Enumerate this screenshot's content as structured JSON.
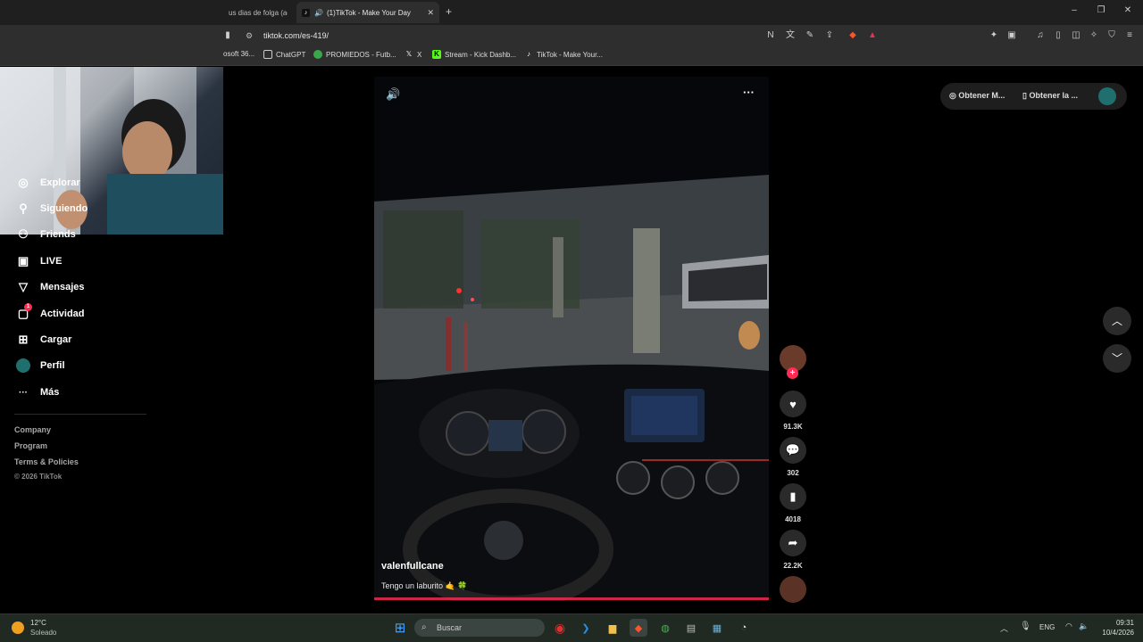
{
  "browser": {
    "tabs": [
      {
        "label": "us dias de folga (acc",
        "active": false
      },
      {
        "label": "(1)TikTok - Make Your Day",
        "active": true
      }
    ],
    "new_tab": "+",
    "window_controls": {
      "minimize": "–",
      "restore": "❐",
      "close": "✕"
    },
    "url": "tiktok.com/es-419/",
    "bookmarks": [
      {
        "label": "osoft 36...",
        "icon": "microsoft-icon"
      },
      {
        "label": "ChatGPT",
        "icon": "chatgpt-icon"
      },
      {
        "label": "PROMIEDOS - Futb...",
        "icon": "promiedos-icon"
      },
      {
        "label": "X",
        "icon": "x-icon"
      },
      {
        "label": "Stream - Kick Dashb...",
        "icon": "kick-icon"
      },
      {
        "label": "TikTok - Make Your...",
        "icon": "tiktok-icon"
      }
    ]
  },
  "sidebar": {
    "items": [
      {
        "label": "Explorar",
        "icon": "compass-icon",
        "glyph": "◎"
      },
      {
        "label": "Siguiendo",
        "icon": "person-icon",
        "glyph": "⚇"
      },
      {
        "label": "Friends",
        "icon": "friends-icon",
        "glyph": "⚇"
      },
      {
        "label": "LIVE",
        "icon": "live-tv-icon",
        "glyph": "▣"
      },
      {
        "label": "Mensajes",
        "icon": "send-icon",
        "glyph": "▽"
      },
      {
        "label": "Actividad",
        "icon": "activity-icon",
        "glyph": "▢",
        "badge": "1"
      },
      {
        "label": "Cargar",
        "icon": "upload-plus-icon",
        "glyph": "⊞"
      },
      {
        "label": "Perfil",
        "icon": "avatar",
        "glyph": ""
      },
      {
        "label": "Más",
        "icon": "more-icon",
        "glyph": "···"
      }
    ],
    "footer": [
      "Company",
      "Program",
      "Terms & Policies",
      "© 2026 TikTok"
    ]
  },
  "header_buttons": {
    "get_coins": "Obtener M...",
    "get_app": "Obtener la ..."
  },
  "video": {
    "username": "valenfullcane",
    "caption": "Tengo un laburito 🤙 🍀",
    "progress": 0.0
  },
  "actions": {
    "likes": "91.3K",
    "comments": "302",
    "saves": "4018",
    "shares": "22.2K"
  },
  "taskbar": {
    "weather_temp": "12°C",
    "weather_desc": "Soleado",
    "search_placeholder": "Buscar",
    "language": "ENG",
    "time": "09:31",
    "date": "10/4/2026"
  },
  "colors": {
    "accent": "#fe2c55",
    "avatar": "#1f6f6f"
  }
}
